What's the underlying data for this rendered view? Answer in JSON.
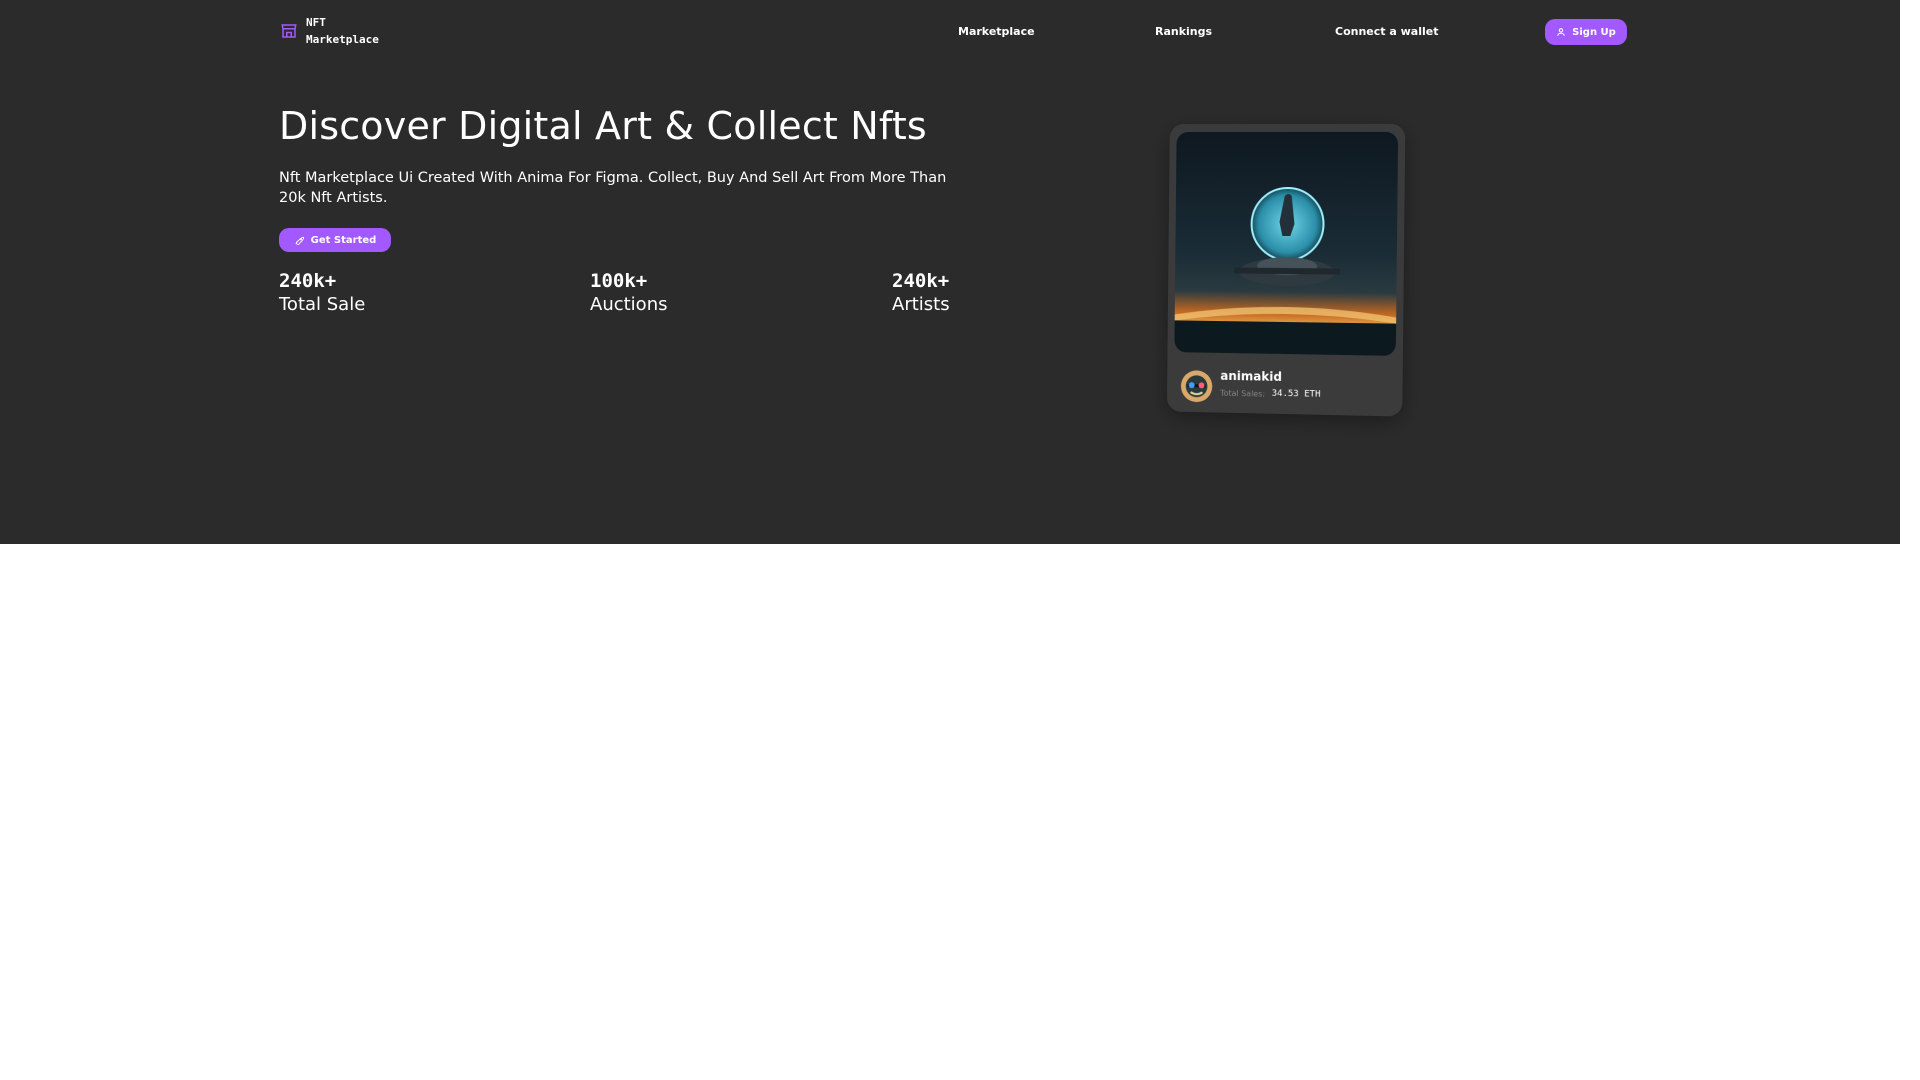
{
  "brand": {
    "line1": "NFT",
    "line2": "Marketplace",
    "icon": "storefront-icon"
  },
  "nav": {
    "items": [
      {
        "label": "Marketplace"
      },
      {
        "label": "Rankings"
      },
      {
        "label": "Connect a wallet"
      }
    ],
    "signup_label": "Sign Up",
    "signup_icon": "user-icon"
  },
  "hero": {
    "headline": "Discover Digital Art & Collect Nfts",
    "subtext": "Nft Marketplace Ui Created With Anima For Figma. Collect, Buy And Sell Art From More Than 20k Nft Artists.",
    "cta_label": "Get Started",
    "cta_icon": "rocket-icon",
    "stats": [
      {
        "value": "240k+",
        "label": "Total Sale"
      },
      {
        "value": "100k+",
        "label": "Auctions"
      },
      {
        "value": "240k+",
        "label": "Artists"
      }
    ]
  },
  "card": {
    "artist": "animakid",
    "sales_label": "Total Sales:",
    "sales_value": "34.53 ETH"
  },
  "colors": {
    "background": "#2b2b2b",
    "accent": "#a259ff",
    "card": "#3b3b3b",
    "page": "#ffffff"
  }
}
